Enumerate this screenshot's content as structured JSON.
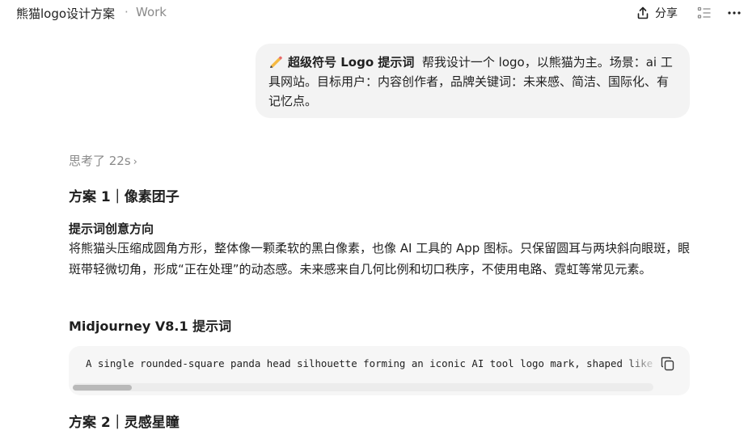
{
  "header": {
    "conversation_title": "熊猫logo设计方案",
    "separator": "·",
    "project_name": "Work",
    "share_label": "分享",
    "share_icon": "share-upload-icon",
    "outline_icon": "list-outline-icon",
    "more_icon": "more-horizontal-icon"
  },
  "user_message": {
    "icon": "pencil-icon",
    "tag": "超级符号 Logo 提示词",
    "text": "帮我设计一个 logo，以熊猫为主。场景：ai 工具网站。目标用户：内容创作者，品牌关键词：未来感、简洁、国际化、有记忆点。"
  },
  "assistant": {
    "thought_label": "思考了 22s",
    "plan1": {
      "title": "方案 1｜像素团子",
      "section_label": "提示词创意方向",
      "description": "将熊猫头压缩成圆角方形，整体像一颗柔软的黑白像素，也像 AI 工具的 App 图标。只保留圆耳与两块斜向眼斑，眼斑带轻微切角，形成“正在处理”的动态感。未来感来自几何比例和切口秩序，不使用电路、霓虹等常见元素。",
      "prompt_heading": "Midjourney V8.1 提示词",
      "code": "A single rounded-square panda head silhouette forming an iconic AI tool logo mark, shaped like a"
    },
    "plan2": {
      "title": "方案 2｜灵感星瞳"
    }
  },
  "code_block": {
    "copy_icon": "copy-icon",
    "scroll_position": 0.0
  },
  "colors": {
    "background": "#ffffff",
    "bubble": "#f3f3f3",
    "code_background": "#f6f6f6",
    "muted_text": "#8a8a8a"
  }
}
